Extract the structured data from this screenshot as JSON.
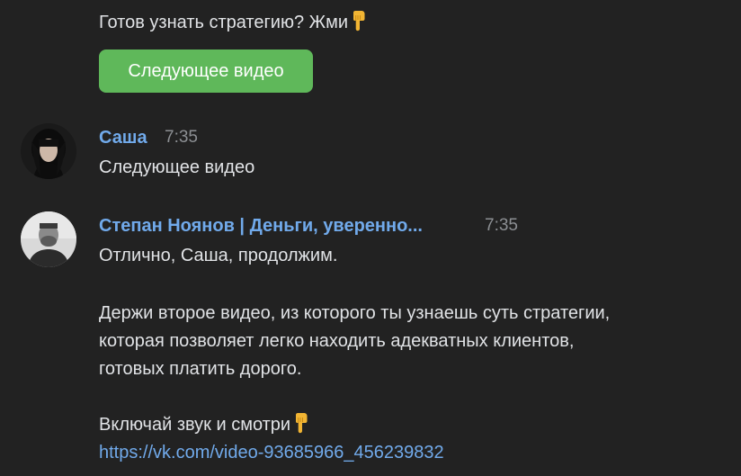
{
  "colors": {
    "background": "#222222",
    "text": "#e1e3e6",
    "author": "#71aaeb",
    "time": "#8c8f93",
    "link": "#71aaeb",
    "button": "#5fb85a"
  },
  "top_message": {
    "text": "Готов узнать стратегию? Жми",
    "emoji": "backhand-index-pointing-down-icon",
    "button_label": "Следующее видео"
  },
  "messages": [
    {
      "author": "Саша",
      "time": "7:35",
      "avatar": "avatar-sasha",
      "lines": [
        "Следующее видео"
      ]
    },
    {
      "author": "Степан Ноянов | Деньги, уверенно...",
      "time": "7:35",
      "avatar": "avatar-stepan",
      "lines": [
        "Отлично, Саша, продолжим.",
        "Держи второе видео, из которого ты узнаешь суть стратегии,",
        "которая позволяет легко находить адекватных клиентов,",
        "готовых платить дорого.",
        "Включай звук и смотри"
      ],
      "link": "https://vk.com/video-93685966_456239832"
    }
  ]
}
